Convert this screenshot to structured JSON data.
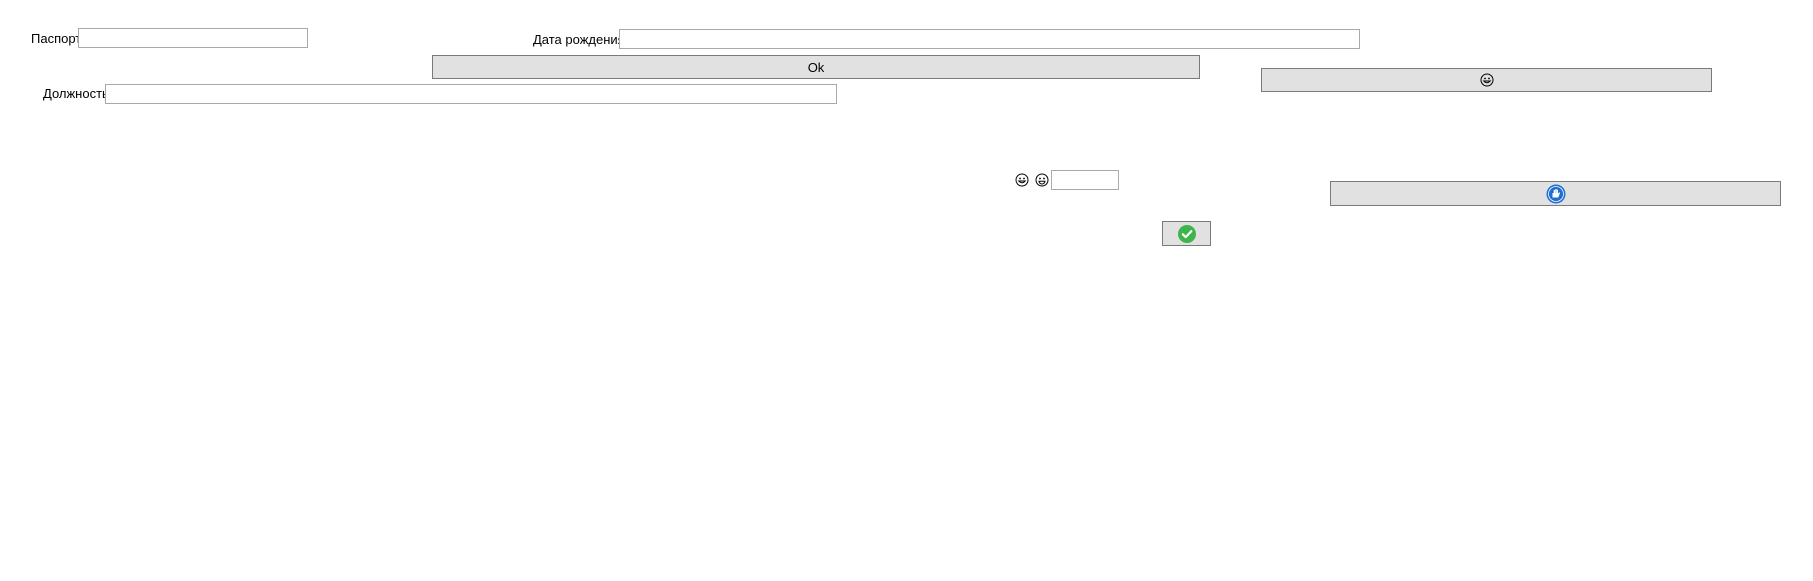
{
  "form": {
    "passport_label": "Паспорт",
    "passport_value": "",
    "birthdate_label": "Дата рождения",
    "birthdate_value": "",
    "position_label": "Должность",
    "position_value": "",
    "ok_label": "Ok",
    "small_field_value": ""
  },
  "icons": {
    "emoji_button_icon": "grinning-face-icon",
    "inline_emoji_1": "grinning-face-icon",
    "inline_emoji_2": "grinning-face-icon",
    "wide_button_icon": "hand-badge-icon",
    "confirm_button_icon": "checkmark-icon"
  },
  "colors": {
    "button_bg": "#e1e1e1",
    "button_border": "#7a7a7a",
    "field_border": "#a9a9a9",
    "confirm_green": "#3cb54a",
    "hand_blue": "#1f6fd1"
  }
}
